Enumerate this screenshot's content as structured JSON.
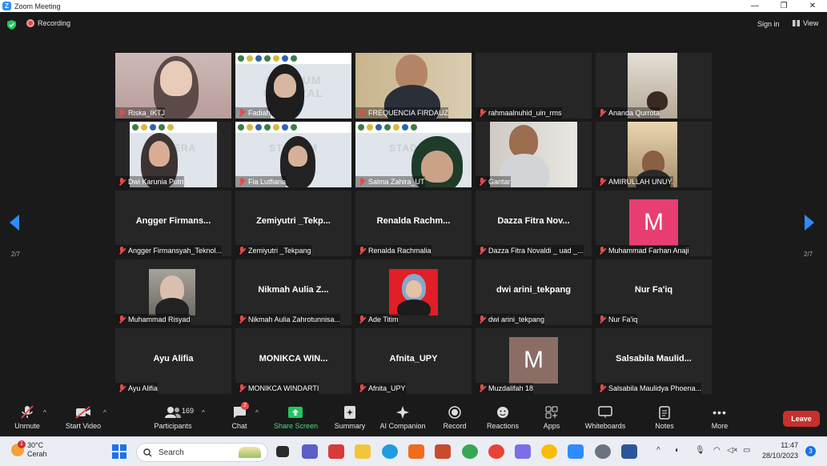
{
  "window": {
    "title": "Zoom Meeting",
    "controls": [
      "—",
      "❐",
      "✕"
    ]
  },
  "top": {
    "recording_label": "Recording",
    "signin_label": "Sign in",
    "view_label": "View"
  },
  "pagination": {
    "left": "2/7",
    "right": "2/7"
  },
  "banner_text": "STADIUM GENERAL",
  "tiles": [
    {
      "name": "Riska_IKTJ",
      "big": "",
      "letter": ""
    },
    {
      "name": "Fadiah",
      "big": "",
      "letter": ""
    },
    {
      "name": "FREQUENCIA FIRDAUZ",
      "big": "",
      "letter": ""
    },
    {
      "name": "rahmaalnuhid_uin_rms",
      "big": "",
      "letter": ""
    },
    {
      "name": "Ananda Qurrota",
      "big": "",
      "letter": ""
    },
    {
      "name": "Dwi Karunia Putri",
      "big": "",
      "letter": ""
    },
    {
      "name": "Fia Lutfiana",
      "big": "",
      "letter": ""
    },
    {
      "name": "Salma Zahira_UT",
      "big": "",
      "letter": ""
    },
    {
      "name": "Gantar",
      "big": "",
      "letter": ""
    },
    {
      "name": "AMIRULLAH UNUY.",
      "big": "",
      "letter": ""
    },
    {
      "name": "Angger Firmansyah_Teknol...",
      "big": "Angger Firmans...",
      "letter": ""
    },
    {
      "name": "Zemiyutri _Tekpang",
      "big": "Zemiyutri _Tekp...",
      "letter": ""
    },
    {
      "name": "Renalda Rachmalia",
      "big": "Renalda Rachm...",
      "letter": ""
    },
    {
      "name": "Dazza Fitra Novaldi _ uad _...",
      "big": "Dazza Fitra Nov...",
      "letter": ""
    },
    {
      "name": "Muhammad Farhan Anaji",
      "big": "",
      "letter": "M"
    },
    {
      "name": "Muhammad Risyad",
      "big": "",
      "letter": ""
    },
    {
      "name": "Nikmah Aulia Zahrotunnisa...",
      "big": "Nikmah Aulia Z...",
      "letter": ""
    },
    {
      "name": "Ade Titim",
      "big": "",
      "letter": ""
    },
    {
      "name": "dwi arini_tekpang",
      "big": "dwi arini_tekpang",
      "letter": ""
    },
    {
      "name": "Nur Fa'iq",
      "big": "Nur Fa'iq",
      "letter": ""
    },
    {
      "name": "Ayu Alifia",
      "big": "Ayu Alifia",
      "letter": ""
    },
    {
      "name": "MONIKCA WINDARTI",
      "big": "MONIKCA WIN...",
      "letter": ""
    },
    {
      "name": "Afnita_UPY",
      "big": "Afnita_UPY",
      "letter": ""
    },
    {
      "name": "Muzdalifah 18",
      "big": "",
      "letter": "M"
    },
    {
      "name": "Salsabila Maulidya Phoena...",
      "big": "Salsabila Maulid...",
      "letter": ""
    }
  ],
  "toolbar": {
    "unmute": "Unmute",
    "start_video": "Start Video",
    "participants": "Participants",
    "participants_count": "169",
    "chat": "Chat",
    "chat_badge": "2",
    "share_screen": "Share Screen",
    "summary": "Summary",
    "ai_companion": "AI Companion",
    "record": "Record",
    "reactions": "Reactions",
    "apps": "Apps",
    "whiteboards": "Whiteboards",
    "notes": "Notes",
    "more": "More",
    "leave": "Leave"
  },
  "taskbar": {
    "weather_temp": "30°C",
    "weather_desc": "Cerah",
    "weather_badge": "1",
    "search_placeholder": "Search",
    "time": "11:47",
    "date": "28/10/2023",
    "notif_count": "3"
  },
  "colors": {
    "accent": "#2d8cff",
    "leave": "#c8302c",
    "share": "#22c55e",
    "avatar_pink": "#e83e72",
    "avatar_brown": "#8a6e66"
  }
}
